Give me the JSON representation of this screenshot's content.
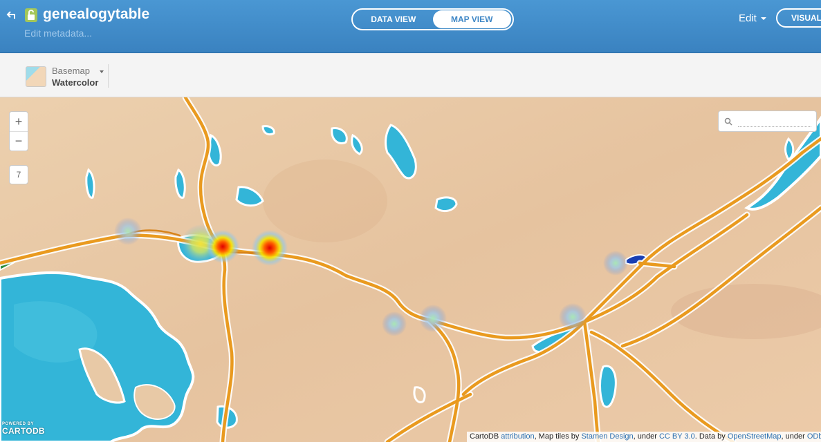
{
  "header": {
    "title": "genealogytable",
    "subtitle": "Edit metadata...",
    "views": [
      {
        "label": "Data View",
        "active": false
      },
      {
        "label": "Map View",
        "active": true
      }
    ],
    "edit_label": "Edit",
    "visualize_label": "VISUALIZE"
  },
  "toolbar": {
    "basemap_label": "Basemap",
    "basemap_value": "Watercolor"
  },
  "map": {
    "zoom_in": "+",
    "zoom_out": "−",
    "zoom_level": "7",
    "search_placeholder": "",
    "logo_small": "POWERED BY",
    "logo_big": "CARTODB",
    "attribution": {
      "part1": "CartoDB",
      "link1": "attribution",
      "part2": ", Map tiles by",
      "link2": "Stamen Design",
      "part3": ", under",
      "link3": "CC BY 3.0",
      "part4": ". Data by",
      "link4": "OpenStreetMap",
      "part5": ", under",
      "link5": "ODbL"
    }
  },
  "colors": {
    "header_blue": "#3f8bcb",
    "land": "#e8c9a6",
    "water": "#3cb8d9",
    "road": "#e99a1f",
    "heat_hot": "#e00000",
    "heat_warm": "#f5e400",
    "heat_cool": "#7fb6e0"
  },
  "icons": [
    "back-arrow-icon",
    "unlock-icon",
    "search-icon"
  ]
}
